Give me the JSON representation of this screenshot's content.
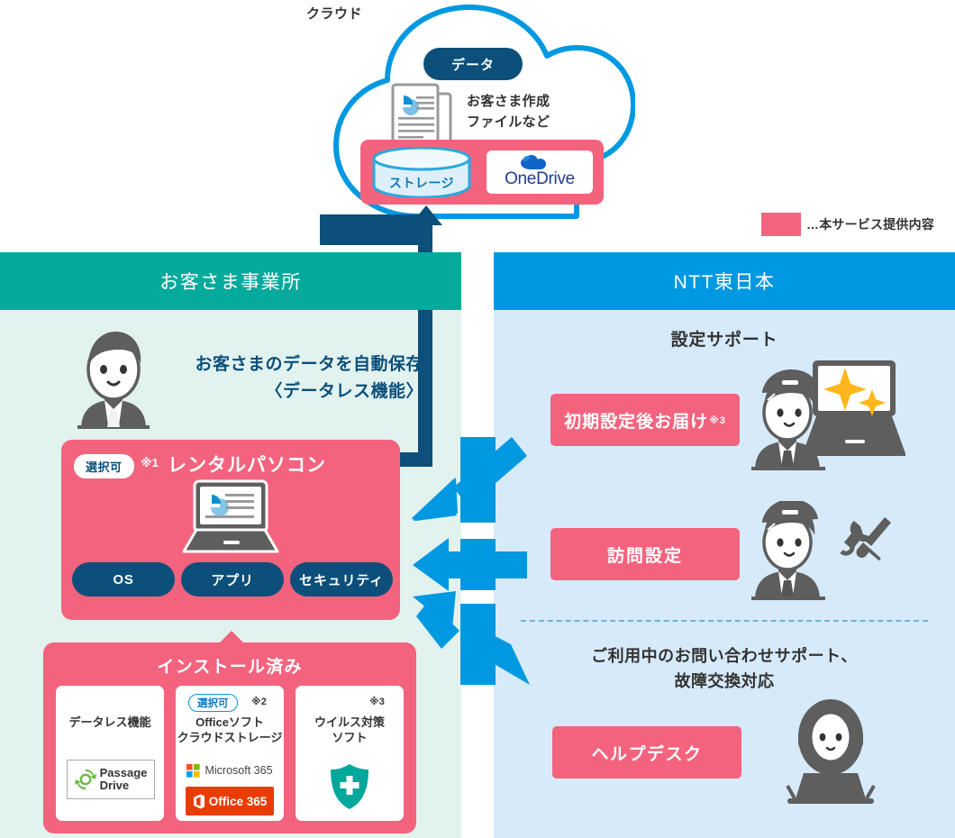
{
  "cloud": {
    "label": "クラウド",
    "data_badge": "データ",
    "file_caption_line1": "お客さま作成",
    "file_caption_line2": "ファイルなど",
    "storage_label": "ストレージ",
    "onedrive_label": "OneDrive",
    "doc_icon": "document-chart-icon",
    "storage_icon": "database-cylinder-icon",
    "onedrive_icon": "onedrive-cloud-icon"
  },
  "legend": {
    "swatch_color": "#f4637e",
    "text": "…本サービス提供内容"
  },
  "left_panel": {
    "title": "お客さま事業所",
    "header_color": "#05aa9c",
    "bg_color": "#e2f2ef",
    "person_icon": "businessman-avatar-icon",
    "autosave_line1": "お客さまのデータを自動保存",
    "autosave_line2": "〈データレス機能〉",
    "rental": {
      "badge": "選択可",
      "note": "※1",
      "title": "レンタルパソコン",
      "laptop_icon": "laptop-chart-icon",
      "pills": [
        "OS",
        "アプリ",
        "セキュリティ"
      ]
    },
    "installed": {
      "title": "インストール済み",
      "items": [
        {
          "label_line1": "データレス機能",
          "label_line2": "",
          "badge": "",
          "note": "",
          "logo": "passage-drive-logo",
          "logo_text_line1": "Passage",
          "logo_text_line2": "Drive"
        },
        {
          "label_line1": "Officeソフト",
          "label_line2": "クラウドストレージ",
          "badge": "選択可",
          "note": "※2",
          "logo": "microsoft-365-logo",
          "ms365_text": "Microsoft 365",
          "office365_text": "Office 365"
        },
        {
          "label_line1": "ウイルス対策",
          "label_line2": "ソフト",
          "badge": "",
          "note": "※3",
          "logo": "shield-antivirus-icon"
        }
      ]
    }
  },
  "right_panel": {
    "title": "NTT東日本",
    "header_color": "#0099e1",
    "bg_color": "#d6eaf9",
    "setup_support_title": "設定サポート",
    "buttons": [
      {
        "label": "初期設定後お届け",
        "note": "※3"
      },
      {
        "label": "訪問設定",
        "note": ""
      },
      {
        "label": "ヘルプデスク",
        "note": ""
      }
    ],
    "staff1_icon": "staff-with-laptop-sparkle-icon",
    "staff2_icon": "staff-with-tools-icon",
    "operator_icon": "headset-operator-icon",
    "usage_line1": "ご利用中のお問い合わせサポート、",
    "usage_line2": "故障交換対応"
  },
  "colors": {
    "rose": "#f4637e",
    "teal": "#05aa9c",
    "blue": "#0099e1",
    "navy": "#0b4f7a",
    "light_teal": "#e2f2ef",
    "light_blue": "#d6eaf9",
    "office_orange": "#eb3c00"
  }
}
